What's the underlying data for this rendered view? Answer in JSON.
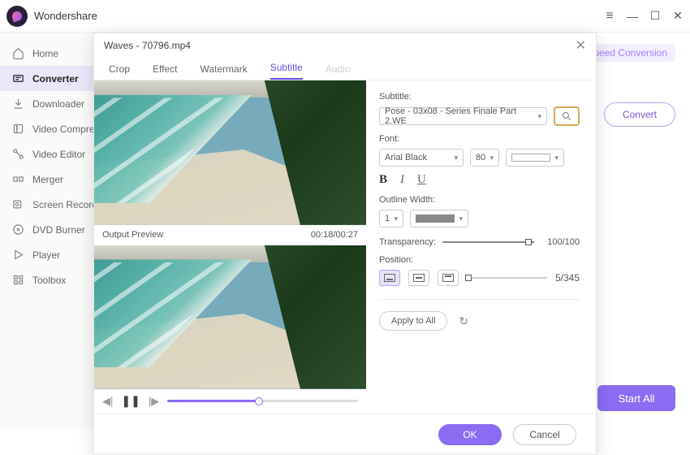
{
  "app": {
    "name": "Wondershare"
  },
  "window_controls": {
    "menu": "≡",
    "min": "—",
    "max": "☐",
    "close": "✕"
  },
  "sidebar": {
    "items": [
      {
        "label": "Home",
        "icon": "home"
      },
      {
        "label": "Converter",
        "icon": "converter"
      },
      {
        "label": "Downloader",
        "icon": "download"
      },
      {
        "label": "Video Compressor",
        "icon": "compress"
      },
      {
        "label": "Video Editor",
        "icon": "editor"
      },
      {
        "label": "Merger",
        "icon": "merger"
      },
      {
        "label": "Screen Recorder",
        "icon": "recorder"
      },
      {
        "label": "DVD Burner",
        "icon": "dvd"
      },
      {
        "label": "Player",
        "icon": "player"
      },
      {
        "label": "Toolbox",
        "icon": "toolbox"
      }
    ],
    "active_index": 1
  },
  "content": {
    "speed_label": "Speed Conversion",
    "convert_label": "Convert",
    "startall_label": "Start All"
  },
  "modal": {
    "title": "Waves - 70796.mp4",
    "tabs": [
      "Crop",
      "Effect",
      "Watermark",
      "Subtitle",
      "Audio"
    ],
    "active_tab_index": 3,
    "disabled_tab_index": 4,
    "preview": {
      "output_label": "Output Preview",
      "timecode": "00:18/00:27"
    },
    "subtitle": {
      "label": "Subtitle:",
      "value": "Pose - 03x08 - Series Finale Part 2.WE"
    },
    "font": {
      "label": "Font:",
      "family": "Arial Black",
      "size": "80"
    },
    "outline": {
      "label": "Outline Width:",
      "width": "1"
    },
    "transparency": {
      "label": "Transparency:",
      "value": "100/100"
    },
    "position": {
      "label": "Position:",
      "value": "5/345"
    },
    "apply_label": "Apply to All",
    "ok_label": "OK",
    "cancel_label": "Cancel"
  }
}
